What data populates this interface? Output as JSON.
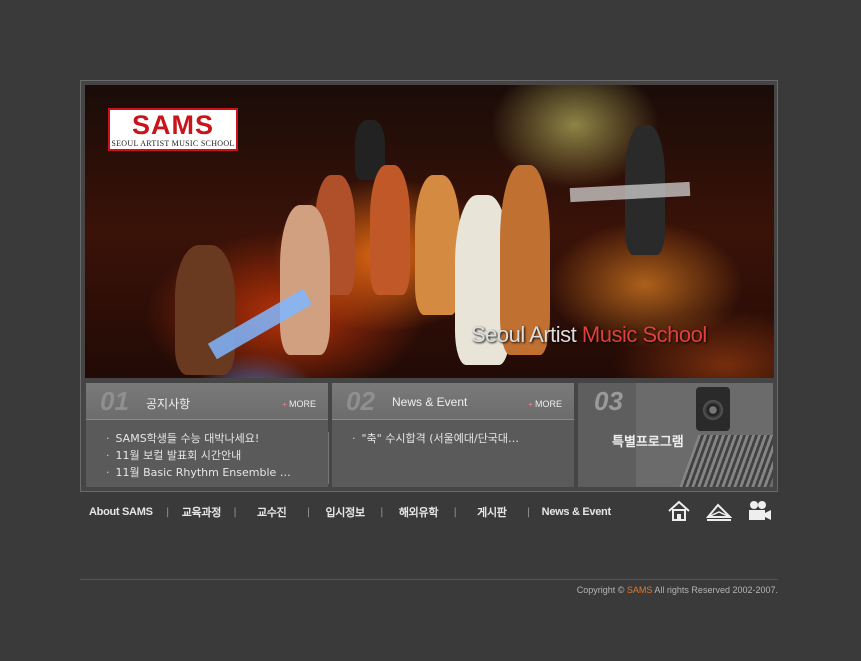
{
  "header": {
    "logo_text": "SAMS",
    "logo_subtitle": "SEOUL ARTIST MUSIC SCHOOL",
    "hero_caption_parts": [
      "Seoul ",
      "Artist ",
      "Music ",
      "School"
    ]
  },
  "panels": [
    {
      "number": "01",
      "title": "공지사항",
      "more_label": "MORE",
      "items": [
        "SAMS학생들 수능 대박나세요!",
        "11월 보컬 발표회 시간안내",
        "11월 Basic Rhythm Ensemble …"
      ]
    },
    {
      "number": "02",
      "title": "News & Event",
      "more_label": "MORE",
      "items": [
        "\"축\" 수시합격 (서울예대/단국대…"
      ]
    },
    {
      "number": "03",
      "title": "특별프로그램"
    }
  ],
  "nav": {
    "items": [
      "About SAMS",
      "교육과정",
      "교수진",
      "입시정보",
      "해외유학",
      "게시판",
      "News & Event"
    ],
    "separator": "|"
  },
  "icons": [
    "home-icon",
    "mail-icon",
    "video-camera-icon"
  ],
  "footer": {
    "copyright_prefix": "Copyright ©",
    "brand": "SAMS",
    "copyright_suffix": "All rights Reserved 2002-2007."
  },
  "colors": {
    "background": "#3a3a3a",
    "logo_red": "#c8141a",
    "footer_brand": "#e07a30"
  }
}
